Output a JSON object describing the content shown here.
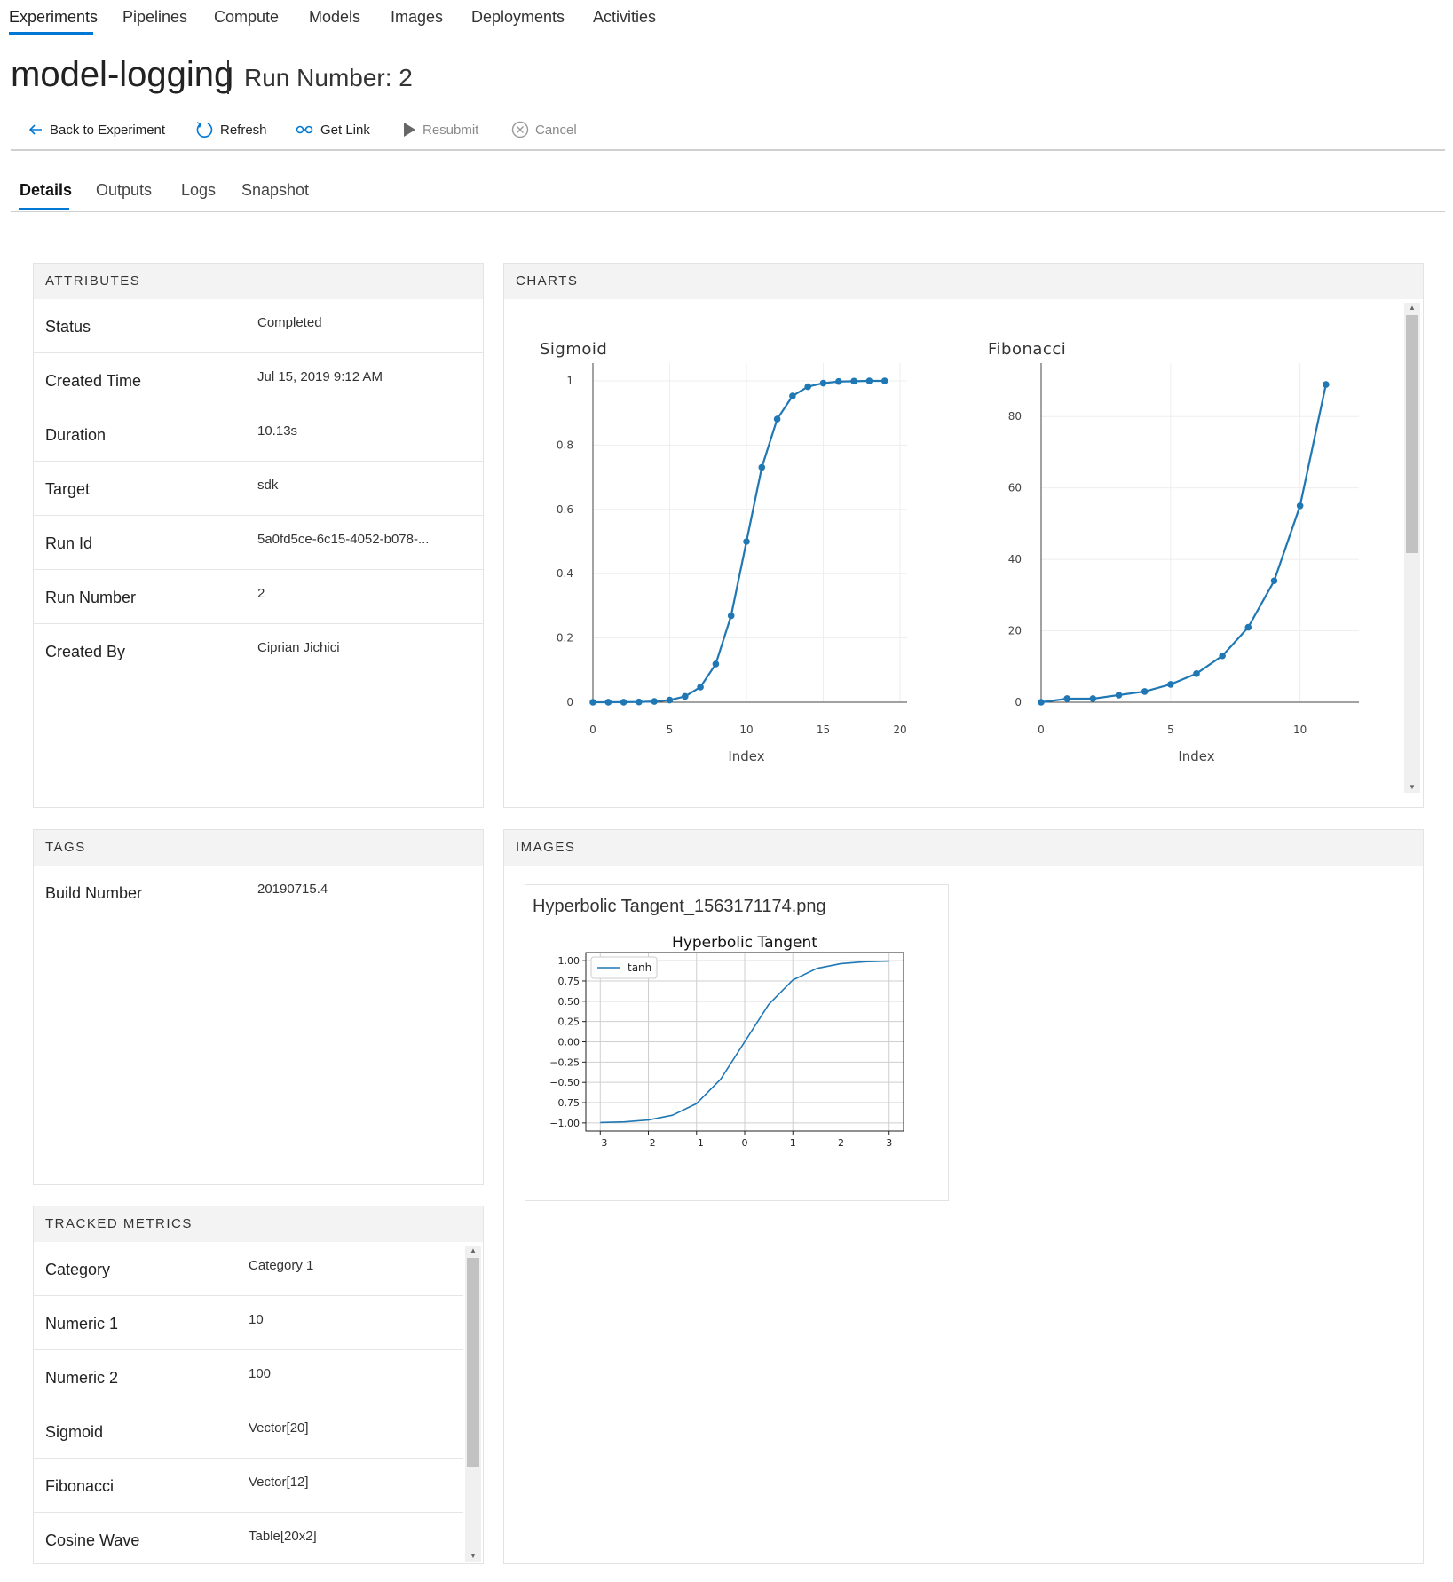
{
  "nav": {
    "items": [
      "Experiments",
      "Pipelines",
      "Compute",
      "Models",
      "Images",
      "Deployments",
      "Activities"
    ],
    "active": "Experiments"
  },
  "header": {
    "title": "model-logging",
    "subtitle": "Run Number: 2"
  },
  "toolbar": {
    "back_label": "Back to Experiment",
    "refresh_label": "Refresh",
    "get_link_label": "Get Link",
    "resubmit_label": "Resubmit",
    "cancel_label": "Cancel"
  },
  "tabs": {
    "items": [
      "Details",
      "Outputs",
      "Logs",
      "Snapshot"
    ],
    "active": "Details"
  },
  "attributes": {
    "header": "ATTRIBUTES",
    "rows": [
      {
        "label": "Status",
        "value": "Completed"
      },
      {
        "label": "Created Time",
        "value": "Jul 15, 2019 9:12 AM"
      },
      {
        "label": "Duration",
        "value": "10.13s"
      },
      {
        "label": "Target",
        "value": "sdk"
      },
      {
        "label": "Run Id",
        "value": "5a0fd5ce-6c15-4052-b078-..."
      },
      {
        "label": "Run Number",
        "value": "2"
      },
      {
        "label": "Created By",
        "value": "Ciprian Jichici"
      }
    ]
  },
  "tags": {
    "header": "TAGS",
    "rows": [
      {
        "label": "Build Number",
        "value": "20190715.4"
      }
    ]
  },
  "metrics": {
    "header": "TRACKED METRICS",
    "rows": [
      {
        "label": "Category",
        "value": "Category 1"
      },
      {
        "label": "Numeric 1",
        "value": "10"
      },
      {
        "label": "Numeric 2",
        "value": "100"
      },
      {
        "label": "Sigmoid",
        "value": "Vector[20]"
      },
      {
        "label": "Fibonacci",
        "value": "Vector[12]"
      },
      {
        "label": "Cosine Wave",
        "value": "Table[20x2]"
      }
    ]
  },
  "charts_panel": {
    "header": "CHARTS"
  },
  "images_panel": {
    "header": "IMAGES",
    "image_name": "Hyperbolic Tangent_1563171174.png"
  },
  "colors": {
    "accent": "#0078d4",
    "series": "#1f77b4"
  },
  "chart_data": [
    {
      "type": "line",
      "title": "Sigmoid",
      "xlabel": "Index",
      "ylabel": "",
      "x": [
        0,
        1,
        2,
        3,
        4,
        5,
        6,
        7,
        8,
        9,
        10,
        11,
        12,
        13,
        14,
        15,
        16,
        17,
        18,
        19
      ],
      "values": [
        0.0,
        0.0001,
        0.0003,
        0.0009,
        0.0025,
        0.0067,
        0.018,
        0.047,
        0.119,
        0.269,
        0.5,
        0.731,
        0.881,
        0.953,
        0.982,
        0.993,
        0.998,
        0.999,
        1.0,
        1.0
      ],
      "xlim": [
        0,
        20
      ],
      "ylim": [
        0,
        1
      ],
      "xticks": [
        0,
        5,
        10,
        15,
        20
      ],
      "yticks": [
        0,
        0.2,
        0.4,
        0.6,
        0.8,
        1
      ],
      "xtick_labels": [
        "0",
        "5",
        "10",
        "15",
        "20"
      ],
      "ytick_labels": [
        "0",
        "0.2",
        "0.4",
        "0.6",
        "0.8",
        "1"
      ],
      "grid": true,
      "markers": true
    },
    {
      "type": "line",
      "title": "Fibonacci",
      "xlabel": "Index",
      "ylabel": "",
      "x": [
        0,
        1,
        2,
        3,
        4,
        5,
        6,
        7,
        8,
        9,
        10,
        11
      ],
      "values": [
        0,
        1,
        1,
        2,
        3,
        5,
        8,
        13,
        21,
        34,
        55,
        89
      ],
      "xlim": [
        0,
        12
      ],
      "ylim": [
        0,
        90
      ],
      "xticks": [
        0,
        5,
        10
      ],
      "yticks": [
        0,
        20,
        40,
        60,
        80
      ],
      "xtick_labels": [
        "0",
        "5",
        "10"
      ],
      "ytick_labels": [
        "0",
        "20",
        "40",
        "60",
        "80"
      ],
      "grid": true,
      "markers": true
    },
    {
      "type": "line",
      "title": "Hyperbolic Tangent",
      "xlabel": "",
      "ylabel": "",
      "x": [
        -3,
        -2.5,
        -2,
        -1.5,
        -1,
        -0.5,
        0,
        0.5,
        1,
        1.5,
        2,
        2.5,
        3
      ],
      "values": [
        -0.995,
        -0.987,
        -0.964,
        -0.905,
        -0.762,
        -0.462,
        0,
        0.462,
        0.762,
        0.905,
        0.964,
        0.987,
        0.995
      ],
      "series": [
        {
          "name": "tanh"
        }
      ],
      "xlim": [
        -3.3,
        3.3
      ],
      "ylim": [
        -1.1,
        1.1
      ],
      "xticks": [
        -3,
        -2,
        -1,
        0,
        1,
        2,
        3
      ],
      "yticks": [
        1.0,
        0.75,
        0.5,
        0.25,
        0.0,
        -0.25,
        -0.5,
        -0.75,
        -1.0
      ],
      "xtick_labels": [
        "−3",
        "−2",
        "−1",
        "0",
        "1",
        "2",
        "3"
      ],
      "ytick_labels": [
        "1.00",
        "0.75",
        "0.50",
        "0.25",
        "0.00",
        "−0.25",
        "−0.50",
        "−0.75",
        "−1.00"
      ],
      "legend": "top-left",
      "grid": true
    }
  ]
}
